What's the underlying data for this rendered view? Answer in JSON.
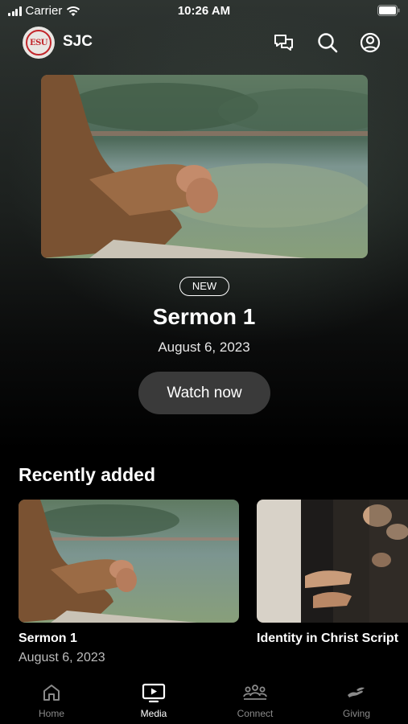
{
  "status_bar": {
    "carrier": "Carrier",
    "time": "10:26 AM"
  },
  "header": {
    "brand": "SJC",
    "logo_text": "ESU"
  },
  "hero": {
    "badge": "NEW",
    "title": "Sermon 1",
    "date": "August 6, 2023",
    "button_label": "Watch now"
  },
  "recently_added": {
    "title": "Recently added",
    "items": [
      {
        "title": "Sermon 1",
        "date": "August 6, 2023"
      },
      {
        "title": "Identity in Christ Script",
        "date": ""
      }
    ]
  },
  "tabs": [
    {
      "label": "Home",
      "icon": "home-icon",
      "active": false
    },
    {
      "label": "Media",
      "icon": "media-icon",
      "active": true
    },
    {
      "label": "Connect",
      "icon": "connect-icon",
      "active": false
    },
    {
      "label": "Giving",
      "icon": "giving-icon",
      "active": false
    }
  ],
  "colors": {
    "accent": "#ffffff",
    "inactive_tab": "#8a8a8a",
    "button_bg": "#3a3a3a"
  }
}
